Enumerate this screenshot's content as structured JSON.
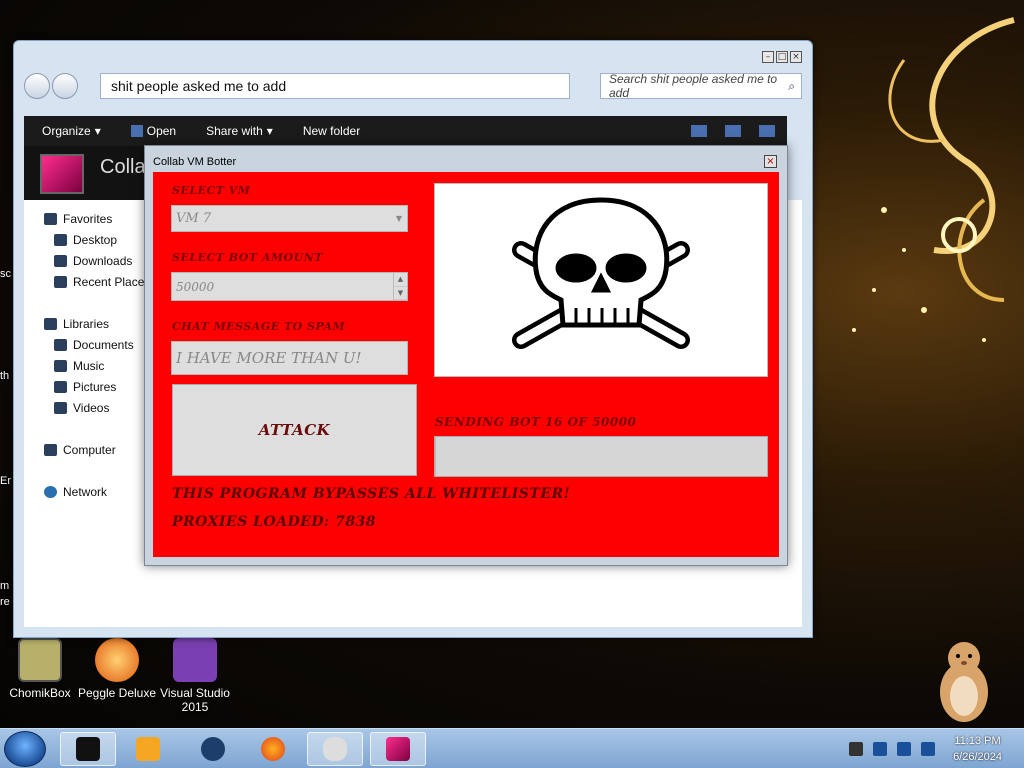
{
  "desktop": {
    "icons": [
      {
        "label": "ChomikBox"
      },
      {
        "label": "Peggle Deluxe"
      },
      {
        "label": "Visual Studio 2015"
      }
    ],
    "left_cut_labels": [
      "sc",
      "th",
      "Er",
      "m",
      "re"
    ]
  },
  "explorer": {
    "window_controls": [
      "–",
      "□",
      "×"
    ],
    "address": "shit people asked me to add",
    "search_placeholder": "Search shit people asked me to add",
    "toolbar": {
      "organize": "Organize",
      "open": "Open",
      "share_with": "Share with",
      "new_folder": "New folder"
    },
    "banner_title": "Collab",
    "nav": {
      "favorites": "Favorites",
      "desktop": "Desktop",
      "downloads": "Downloads",
      "recent_places": "Recent Places",
      "libraries": "Libraries",
      "documents": "Documents",
      "music": "Music",
      "pictures": "Pictures",
      "videos": "Videos",
      "computer": "Computer",
      "network": "Network"
    }
  },
  "botter": {
    "title": "Collab VM Botter",
    "close_label": "×",
    "select_vm_label": "SELECT VM",
    "select_vm_value": "VM 7",
    "select_bot_amount_label": "SELECT BOT AMOUNT",
    "bot_amount_value": "50000",
    "chat_label": "CHAT MESSAGE TO SPAM",
    "chat_value": "I HAVE MORE THAN U!",
    "attack_label": "ATTACK",
    "status_label": "SENDING BOT 16 OF 50000",
    "progress": 0.0003,
    "footer_line1": "THIS PROGRAM BYPASSES ALL WHITELISTER!",
    "footer_line2": "PROXIES LOADED: 7838"
  },
  "taskbar": {
    "time": "11:13 PM",
    "date": "6/26/2024"
  },
  "colors": {
    "dialog_red": "#ff0000",
    "label_dark_red": "#7a0000"
  }
}
